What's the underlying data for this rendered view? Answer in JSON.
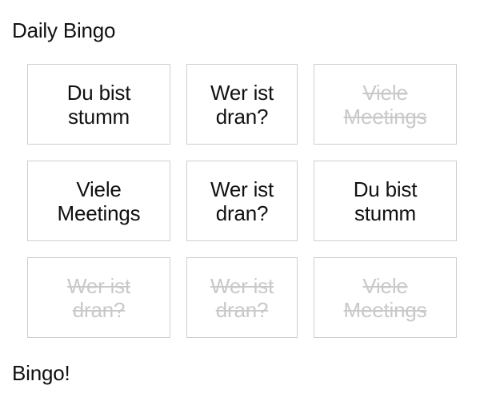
{
  "app": {
    "title": "Daily Bingo",
    "status": "Bingo!"
  },
  "board": {
    "cells": [
      {
        "label": "Du bist\nstumm",
        "marked": false
      },
      {
        "label": "Wer ist\ndran?",
        "marked": false
      },
      {
        "label": "Viele\nMeetings",
        "marked": true
      },
      {
        "label": "Viele\nMeetings",
        "marked": false
      },
      {
        "label": "Wer ist\ndran?",
        "marked": false
      },
      {
        "label": "Du bist\nstumm",
        "marked": false
      },
      {
        "label": "Wer ist\ndran?",
        "marked": true
      },
      {
        "label": "Wer ist\ndran?",
        "marked": true
      },
      {
        "label": "Viele\nMeetings",
        "marked": true
      }
    ]
  },
  "colors": {
    "text": "#111111",
    "marked_text": "#c9c9c9",
    "cell_border": "#cfcfcf",
    "background": "#ffffff"
  }
}
